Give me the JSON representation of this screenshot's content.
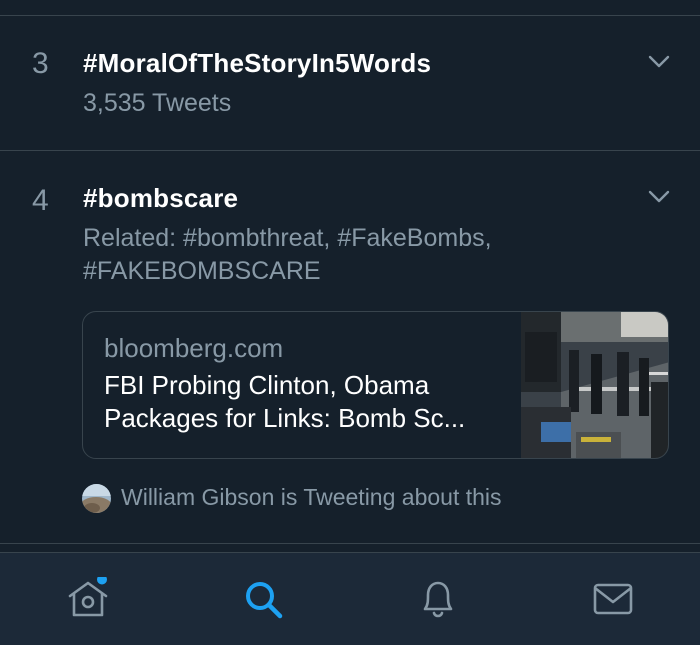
{
  "trends": [
    {
      "rank": "3",
      "tag": "#MoralOfTheStoryIn5Words",
      "meta": "3,535 Tweets"
    },
    {
      "rank": "4",
      "tag": "#bombscare",
      "meta_line1": "Related: #bombthreat, #FakeBombs,",
      "meta_line2": "#FAKEBOMBSCARE",
      "card": {
        "domain": "bloomberg.com",
        "title_line1": "FBI Probing Clinton, Obama",
        "title_line2": "Packages for Links: Bomb Sc..."
      },
      "context": "William Gibson is Tweeting about this"
    }
  ],
  "tabbar": {
    "items": [
      "home-icon",
      "search-icon",
      "notifications-icon",
      "messages-icon"
    ],
    "active": "search-icon",
    "home_unread_dot": true
  },
  "colors": {
    "background": "#15202b",
    "tabbar": "#1c2938",
    "divider": "#38444d",
    "secondary_text": "#8899a6",
    "accent": "#1da1f2"
  }
}
